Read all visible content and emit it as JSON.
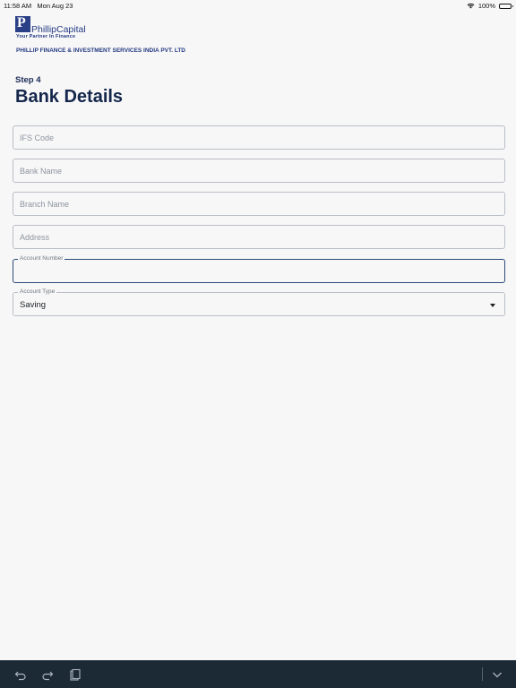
{
  "status": {
    "time": "11:58 AM",
    "date": "Mon Aug 23",
    "battery": "100%"
  },
  "brand": {
    "logo_letter": "P",
    "name": "PhillipCapital",
    "tagline": "Your Partner In Finance",
    "company": "PHILLIP FINANCE & INVESTMENT SERVICES INDIA PVT. LTD"
  },
  "page": {
    "step": "Step 4",
    "title": "Bank Details"
  },
  "form": {
    "ifs_code": {
      "placeholder": "IFS Code",
      "value": ""
    },
    "bank_name": {
      "placeholder": "Bank Name",
      "value": ""
    },
    "branch_name": {
      "placeholder": "Branch Name",
      "value": ""
    },
    "address": {
      "placeholder": "Address",
      "value": ""
    },
    "account_number": {
      "label": "Account Number",
      "value": ""
    },
    "account_type": {
      "label": "Account Type",
      "value": "Saving"
    }
  },
  "icons": {
    "wifi": "wifi-icon",
    "battery": "battery-icon",
    "undo": "undo-icon",
    "redo": "redo-icon",
    "clipboard": "clipboard-icon",
    "keyboard_hide": "chevron-down-icon"
  },
  "colors": {
    "brand": "#243a80",
    "active_border": "#2c4a78",
    "toolbar": "#1c2a35"
  }
}
